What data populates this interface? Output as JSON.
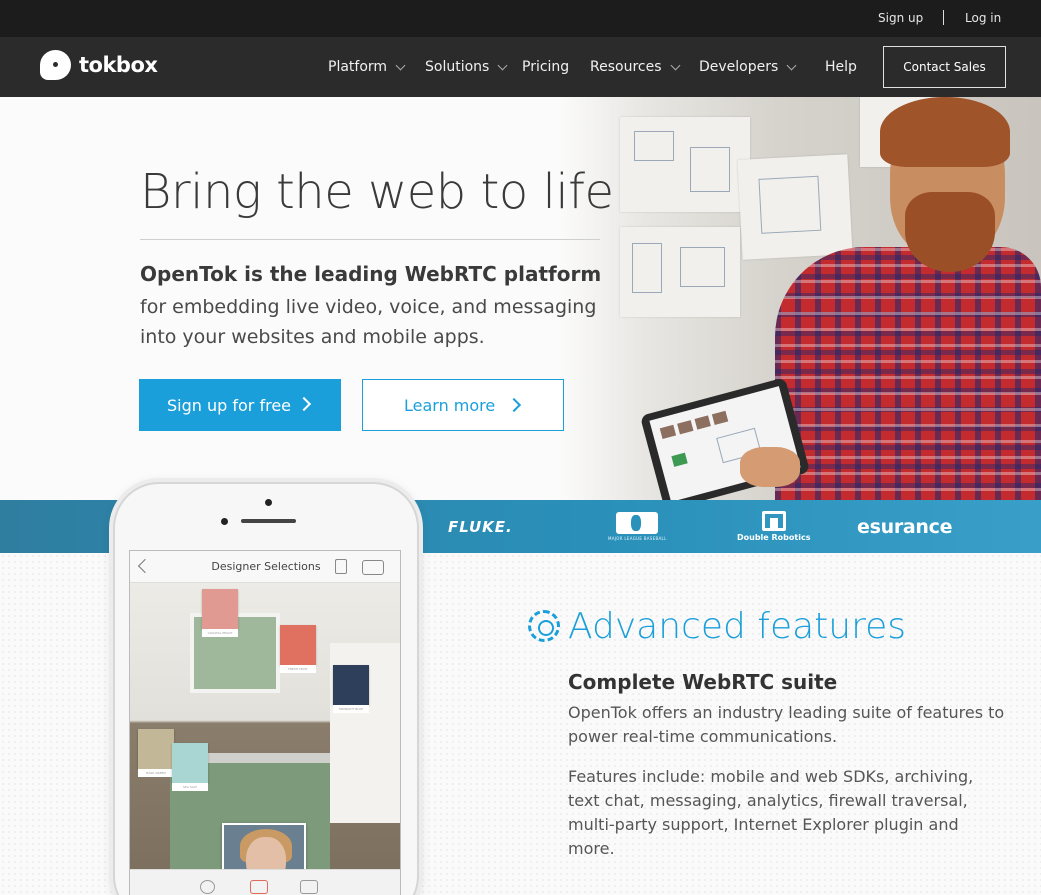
{
  "topbar": {
    "signup": "Sign up",
    "login": "Log in"
  },
  "nav": {
    "logo": "tokbox",
    "items": [
      {
        "label": "Platform",
        "has_dropdown": true
      },
      {
        "label": "Solutions",
        "has_dropdown": true
      },
      {
        "label": "Pricing",
        "has_dropdown": false
      },
      {
        "label": "Resources",
        "has_dropdown": true
      },
      {
        "label": "Developers",
        "has_dropdown": true
      },
      {
        "label": "Help",
        "has_dropdown": false
      }
    ],
    "contact": "Contact Sales"
  },
  "hero": {
    "title": "Bring the web to life",
    "lead": "OpenTok is the leading WebRTC platform",
    "sub": "for embedding live video, voice, and messaging into your websites and mobile apps.",
    "primary_button": "Sign up for free",
    "secondary_button": "Learn more"
  },
  "logos": {
    "fluke": "FLUKE.",
    "mlb": "MAJOR LEAGUE BASEBALL",
    "double_robotics": "Double Robotics",
    "esurance": "esurance"
  },
  "phone": {
    "app_title": "Designer Selections",
    "swatches": [
      {
        "name": "COASTAL PEACH",
        "color": "#e09a92"
      },
      {
        "name": "FRESH FRUIT",
        "color": "#e0705f"
      },
      {
        "name": "MIDNIGHT BLUE",
        "color": "#2e3f5c"
      },
      {
        "name": "BASK GREEN",
        "color": "#c2b898"
      },
      {
        "name": "SEA SALT",
        "color": "#a9d6d2"
      }
    ]
  },
  "features": {
    "title": "Advanced features",
    "subtitle": "Complete WebRTC suite",
    "p1": "OpenTok offers an industry leading suite of features to power real-time communications.",
    "p2": "Features include: mobile and web SDKs, archiving, text chat, messaging, analytics, firewall traversal, multi-party support, Internet Explorer plugin and more."
  },
  "colors": {
    "accent": "#1b9fda",
    "topbar": "#1c1c1c",
    "navbar": "#2b2b2b"
  }
}
